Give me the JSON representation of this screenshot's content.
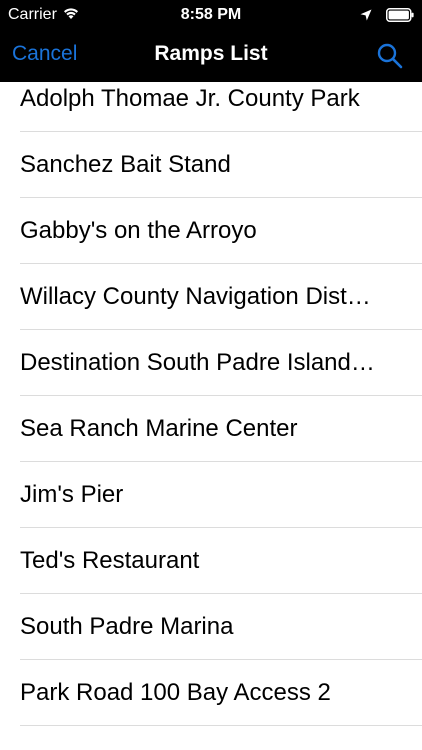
{
  "status_bar": {
    "carrier": "Carrier",
    "time": "8:58 PM",
    "icons": [
      "wifi-icon",
      "location-arrow-icon",
      "battery-icon"
    ]
  },
  "nav": {
    "cancel_label": "Cancel",
    "title": "Ramps List",
    "search_icon": "search-icon",
    "accent_color": "#1a73d9"
  },
  "ramps": [
    {
      "label": "Adolph Thomae Jr. County Park"
    },
    {
      "label": "Sanchez Bait Stand"
    },
    {
      "label": "Gabby's on the Arroyo"
    },
    {
      "label": "Willacy County Navigation Dist…"
    },
    {
      "label": "Destination South Padre Island…"
    },
    {
      "label": "Sea Ranch Marine Center"
    },
    {
      "label": "Jim's Pier"
    },
    {
      "label": "Ted's Restaurant"
    },
    {
      "label": "South Padre Marina"
    },
    {
      "label": "Park Road 100 Bay Access 2"
    }
  ]
}
